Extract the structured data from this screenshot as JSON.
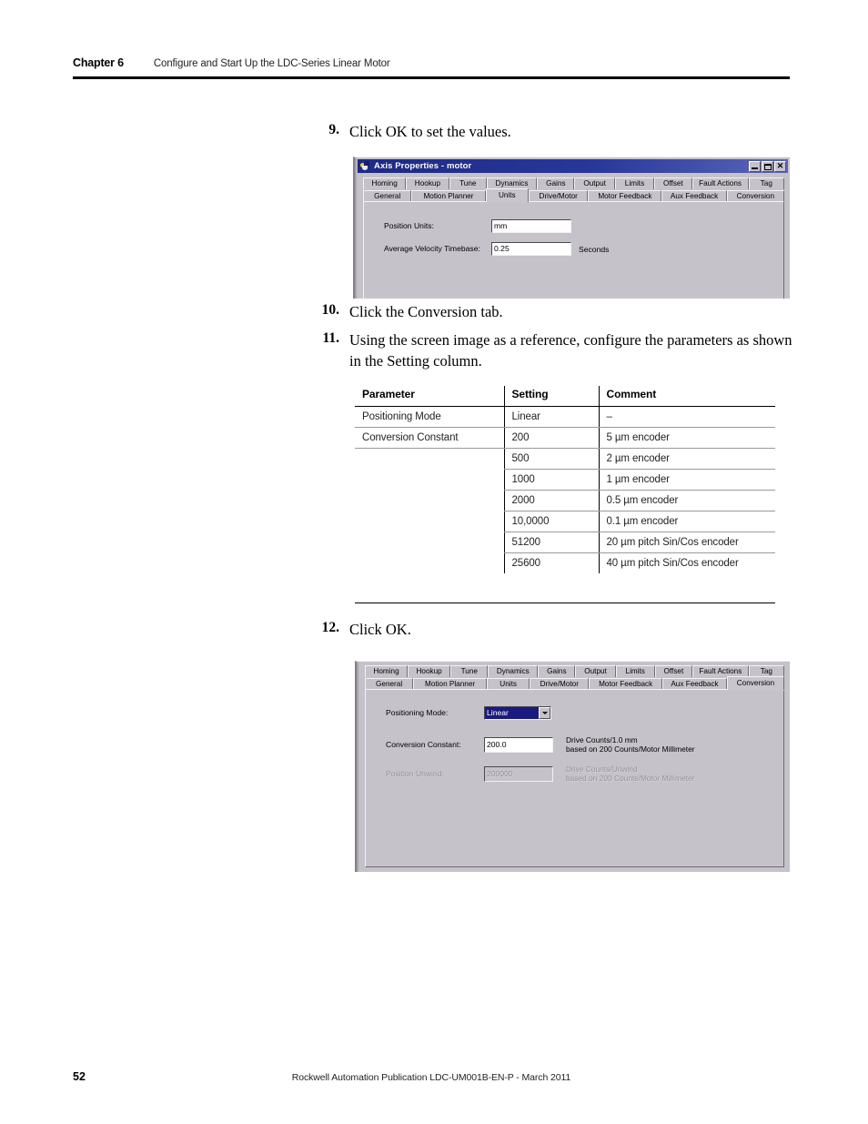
{
  "header": {
    "chapter": "Chapter 6",
    "title": "Configure and Start Up the LDC-Series Linear Motor"
  },
  "steps": {
    "s9": {
      "num": "9.",
      "text": "Click OK to set the values."
    },
    "s10": {
      "num": "10.",
      "text": "Click the Conversion tab."
    },
    "s11": {
      "num": "11.",
      "text": "Using the screen image as a reference, configure the parameters as shown in the Setting column."
    },
    "s12": {
      "num": "12.",
      "text": "Click OK."
    }
  },
  "dialog1": {
    "title": "Axis Properties - motor",
    "icon": "axis-properties-icon",
    "buttons": {
      "minimize": "minimize-button",
      "maximize": "maximize-button",
      "close": "close-button"
    },
    "tabs_row1": [
      "Homing",
      "Hookup",
      "Tune",
      "Dynamics",
      "Gains",
      "Output",
      "Limits",
      "Offset",
      "Fault Actions",
      "Tag"
    ],
    "tabs_row2": [
      "General",
      "Motion Planner",
      "Units",
      "Drive/Motor",
      "Motor Feedback",
      "Aux Feedback",
      "Conversion"
    ],
    "active_tab": "Units",
    "fields": {
      "position_units_label": "Position Units:",
      "position_units_value": "mm",
      "avg_velocity_label": "Average Velocity Timebase:",
      "avg_velocity_value": "0.25",
      "avg_velocity_suffix": "Seconds"
    }
  },
  "dialog2": {
    "tabs_row1": [
      "Homing",
      "Hookup",
      "Tune",
      "Dynamics",
      "Gains",
      "Output",
      "Limits",
      "Offset",
      "Fault Actions",
      "Tag"
    ],
    "tabs_row2": [
      "General",
      "Motion Planner",
      "Units",
      "Drive/Motor",
      "Motor Feedback",
      "Aux Feedback",
      "Conversion"
    ],
    "active_tab": "Conversion",
    "fields": {
      "positioning_mode_label": "Positioning Mode:",
      "positioning_mode_value": "Linear",
      "conversion_constant_label": "Conversion Constant:",
      "conversion_constant_value": "200.0",
      "conversion_constant_note": "Drive Counts/1.0 mm\nbased on 200 Counts/Motor Millimeter",
      "position_unwind_label": "Position Unwind:",
      "position_unwind_value": "200000",
      "position_unwind_note": "Drive Counts/Unwind\nbased on 200 Counts/Motor Millimeter"
    }
  },
  "table": {
    "headers": [
      "Parameter",
      "Setting",
      "Comment"
    ],
    "rows": [
      {
        "parameter": "Positioning Mode",
        "setting": "Linear",
        "comment": "–"
      },
      {
        "parameter": "Conversion Constant",
        "setting": "200",
        "comment": "5 µm encoder"
      },
      {
        "parameter": "",
        "setting": "500",
        "comment": "2 µm encoder"
      },
      {
        "parameter": "",
        "setting": "1000",
        "comment": "1 µm encoder"
      },
      {
        "parameter": "",
        "setting": "2000",
        "comment": "0.5 µm encoder"
      },
      {
        "parameter": "",
        "setting": "10,0000",
        "comment": "0.1 µm encoder"
      },
      {
        "parameter": "",
        "setting": "51200",
        "comment": "20 µm pitch Sin/Cos encoder"
      },
      {
        "parameter": "",
        "setting": "25600",
        "comment": "40 µm pitch Sin/Cos encoder"
      }
    ]
  },
  "footer": {
    "page_number": "52",
    "publication": "Rockwell Automation Publication LDC-UM001B-EN-P - March 2011"
  },
  "colors": {
    "titlebar_start": "#1d2a86",
    "titlebar_end": "#5b66b8",
    "dialog_face": "#c6c2ca",
    "combo_highlight": "#1a1a80",
    "rule": "#000000"
  }
}
